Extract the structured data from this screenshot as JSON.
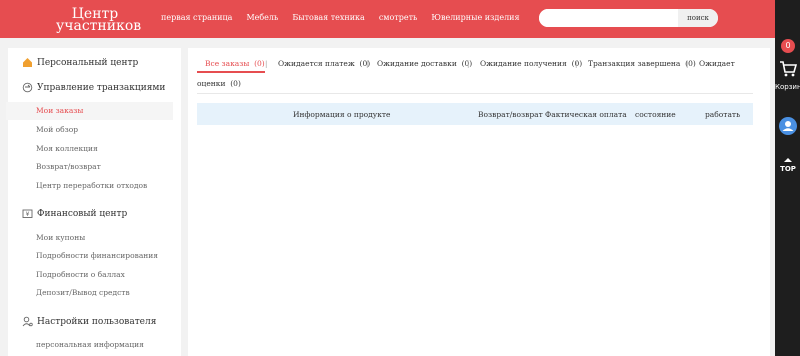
{
  "header": {
    "logo_line1": "Центр",
    "logo_line2": "участников",
    "nav": [
      "первая страница",
      "Мебель",
      "Бытовая техника",
      "смотреть",
      "Ювелирные изделия"
    ],
    "search_placeholder": "",
    "search_button": "поиск"
  },
  "rightbar": {
    "cart_count": "0",
    "cart_label": "Корзина",
    "top_label": "TOP"
  },
  "sidebar": {
    "personal_center": "Персональный центр",
    "transactions": {
      "title": "Управление транзакциями",
      "items": [
        "Мои заказы",
        "Мой обзор",
        "Моя коллекция",
        "Возврат/возврат",
        "Центр переработки отходов"
      ]
    },
    "finance": {
      "title": "Финансовый центр",
      "items": [
        "Мои купоны",
        "Подробности финансирования",
        "Подробности о баллах",
        "Депозит/Вывод средств"
      ]
    },
    "settings": {
      "title": "Настройки пользователя",
      "items": [
        "персональная информация"
      ]
    }
  },
  "tabs": [
    {
      "label": "Все заказы",
      "count": "(0)"
    },
    {
      "label": "Ожидается платеж",
      "count": "(0)"
    },
    {
      "label": "Ожидание доставки",
      "count": "(0)"
    },
    {
      "label": "Ожидание получения",
      "count": "(0)"
    },
    {
      "label": "Транзакция завершена",
      "count": "(0)"
    },
    {
      "label": "Ожидает оценки",
      "count": "(0)"
    }
  ],
  "tabs_wrap": {
    "line1_last": "Ожидает",
    "line2": "оценки",
    "line2_count": "(0)"
  },
  "table_headers": [
    "Информация о продукте",
    "Возврат/возврат",
    "Фактическая оплата",
    "состояние",
    "работать"
  ],
  "colors": {
    "brand": "#e64d50",
    "table_header_bg": "#e6f2fb",
    "right_bar": "#1e1e1e"
  }
}
